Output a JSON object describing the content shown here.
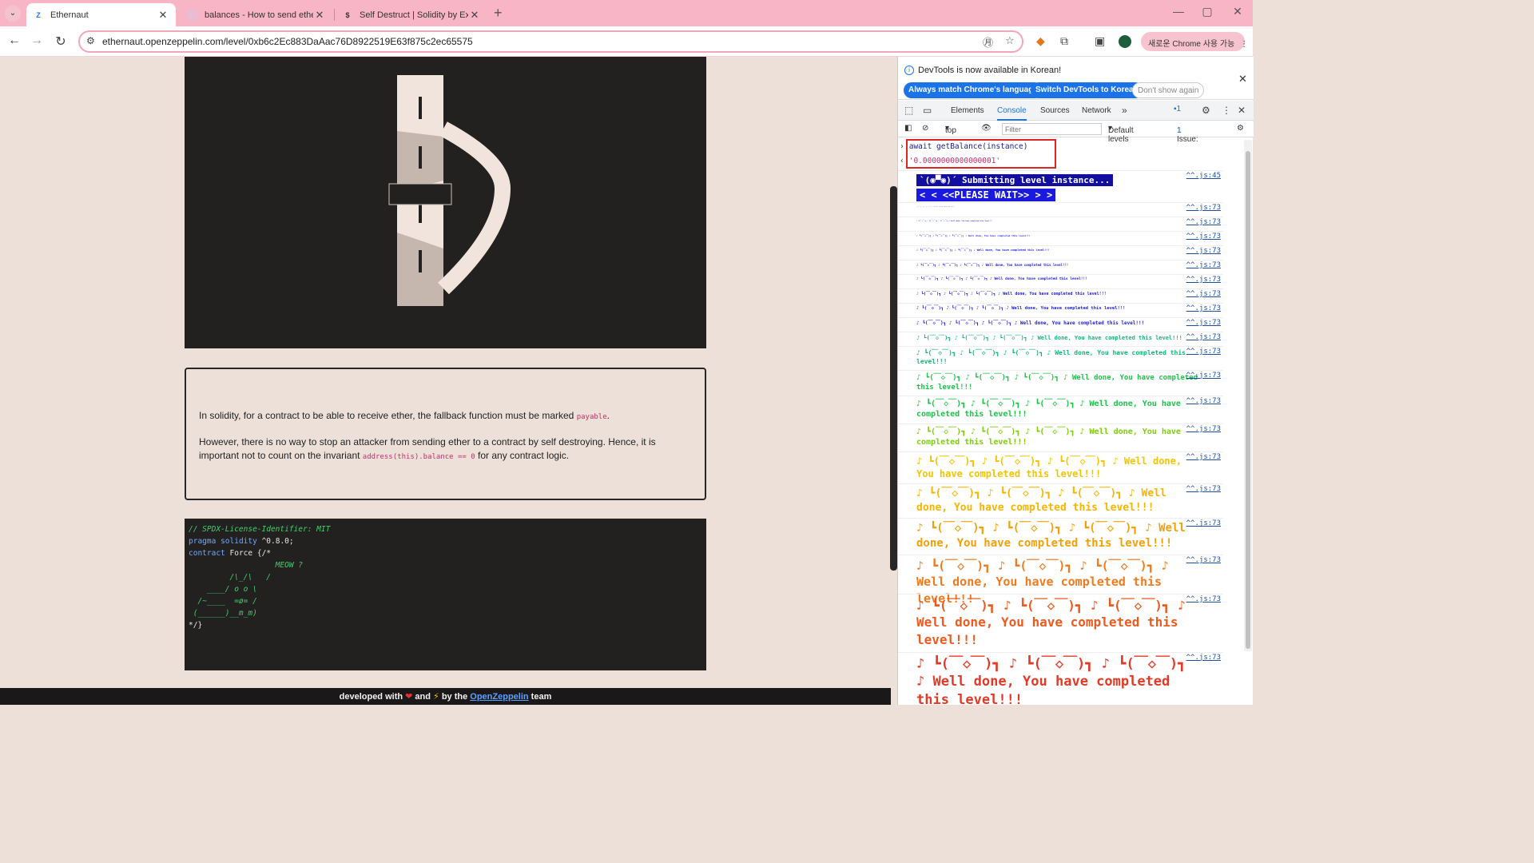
{
  "tabs": [
    {
      "title": "Ethernaut",
      "active": true
    },
    {
      "title": "balances - How to send ether",
      "active": false
    },
    {
      "title": "Self Destruct | Solidity by Exan",
      "active": false
    }
  ],
  "window_controls": {
    "minimize": "—",
    "restore": "▢",
    "close": "✕"
  },
  "toolbar": {
    "url": "ethernaut.openzeppelin.com/level/0xb6c2Ec883DaAac76D8922519E63f875c2ec65575",
    "chrome_new": "새로운 Chrome 사용 가능"
  },
  "page": {
    "desc_p1_before": "In solidity, for a contract to be able to receive ether, the fallback function must be marked ",
    "desc_p1_code": "payable",
    "desc_p1_after": ".",
    "desc_p2_before": "However, there is no way to stop an attacker from sending ether to a contract by self destroying. Hence, it is important not to count on the invariant ",
    "desc_p2_code": "address(this).balance == 0",
    "desc_p2_after": " for any contract logic.",
    "code_lines": [
      "// SPDX-License-Identifier: MIT",
      "pragma solidity ^0.8.0;",
      "",
      "contract Force {/*",
      "",
      "                   MEOW ?",
      "         /\\_/\\   /",
      "    ____/ o o \\",
      "  /~____  =ø= /",
      " (______)__m_m)",
      "",
      "*/}"
    ],
    "footer_before": "developed with ",
    "footer_and": " and ",
    "footer_by": " by the ",
    "footer_link": "OpenZeppelin",
    "footer_after": " team"
  },
  "devtools": {
    "banner_msg": "DevTools is now available in Korean!",
    "btn_match": "Always match Chrome's language",
    "btn_switch": "Switch DevTools to Korean",
    "btn_dont": "Don't show again",
    "tabs": [
      "Elements",
      "Console",
      "Sources",
      "Network"
    ],
    "active_tab": "Console",
    "issue_badge": "1",
    "context": "top",
    "filter_placeholder": "Filter",
    "levels": "Default levels",
    "issues": "1 Issue:",
    "issues_count": "1",
    "cmd_input": "await getBalance(instance)",
    "cmd_output": "'0.0000000000000001'",
    "wait_line1": "`(◉▀◉)´ Submitting level instance...",
    "wait_line2": "<  < <<PLEASE WAIT>> >  >",
    "wait_src": "^^.js:45",
    "log_src": "^^.js:73",
    "log_message": "♪ ┗(￣◇￣)┓ ♪ ┗(￣◇￣)┓ ♪ ┗(￣◇￣)┓ ♪ Well done, You have completed this level!!!",
    "log_colors": [
      "#1a1adf",
      "#1a1adf",
      "#1a1adf",
      "#1a1adf",
      "#1a1adf",
      "#1a1adf",
      "#1a1adf",
      "#1a1adf",
      "#1a1adf",
      "#13b57a",
      "#13b57a",
      "#1fc04a",
      "#1fc04a",
      "#7ecb12",
      "#f2c400",
      "#f7b400",
      "#f2a007",
      "#ef7b1e",
      "#ec5a1e",
      "#e23a26"
    ],
    "log_sizes": [
      1,
      2,
      3,
      3.5,
      4,
      4.5,
      5,
      5.5,
      6,
      7,
      8,
      9,
      10,
      10,
      12,
      13,
      14,
      15,
      16,
      17
    ]
  }
}
